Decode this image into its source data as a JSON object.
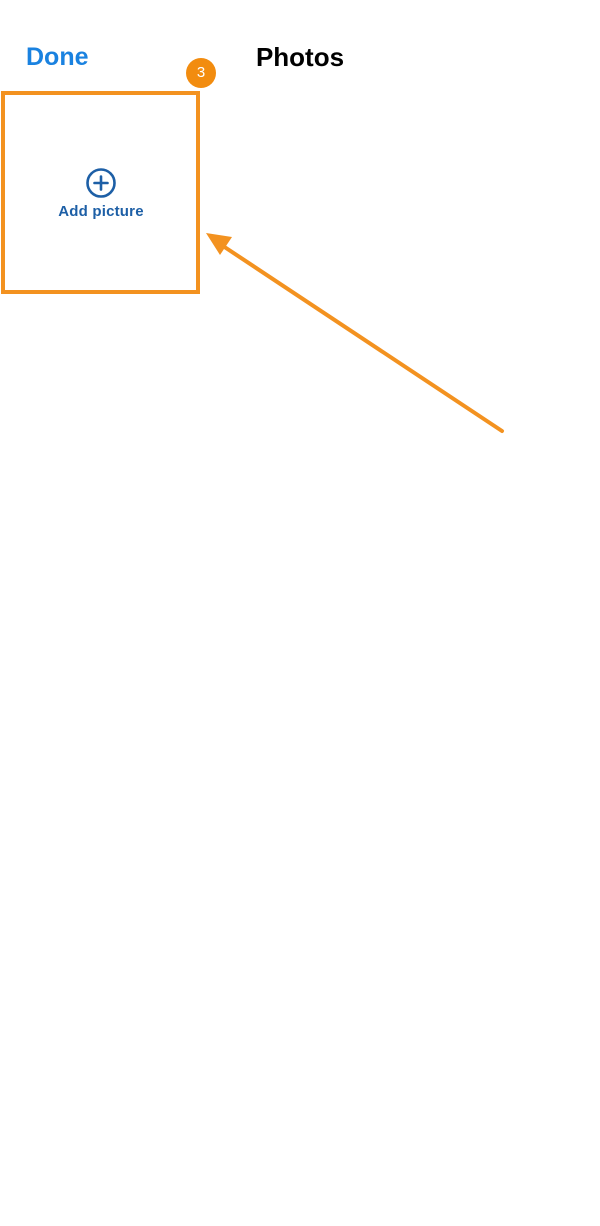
{
  "nav": {
    "done_label": "Done",
    "title": "Photos"
  },
  "grid": {
    "add_tile": {
      "icon": "plus-circle-icon",
      "label": "Add picture"
    }
  },
  "annotation": {
    "step_number": "3",
    "color": "#f39220"
  },
  "colors": {
    "accent": "#1a82e0",
    "tile_text": "#1d5fa6",
    "highlight": "#f39220"
  }
}
